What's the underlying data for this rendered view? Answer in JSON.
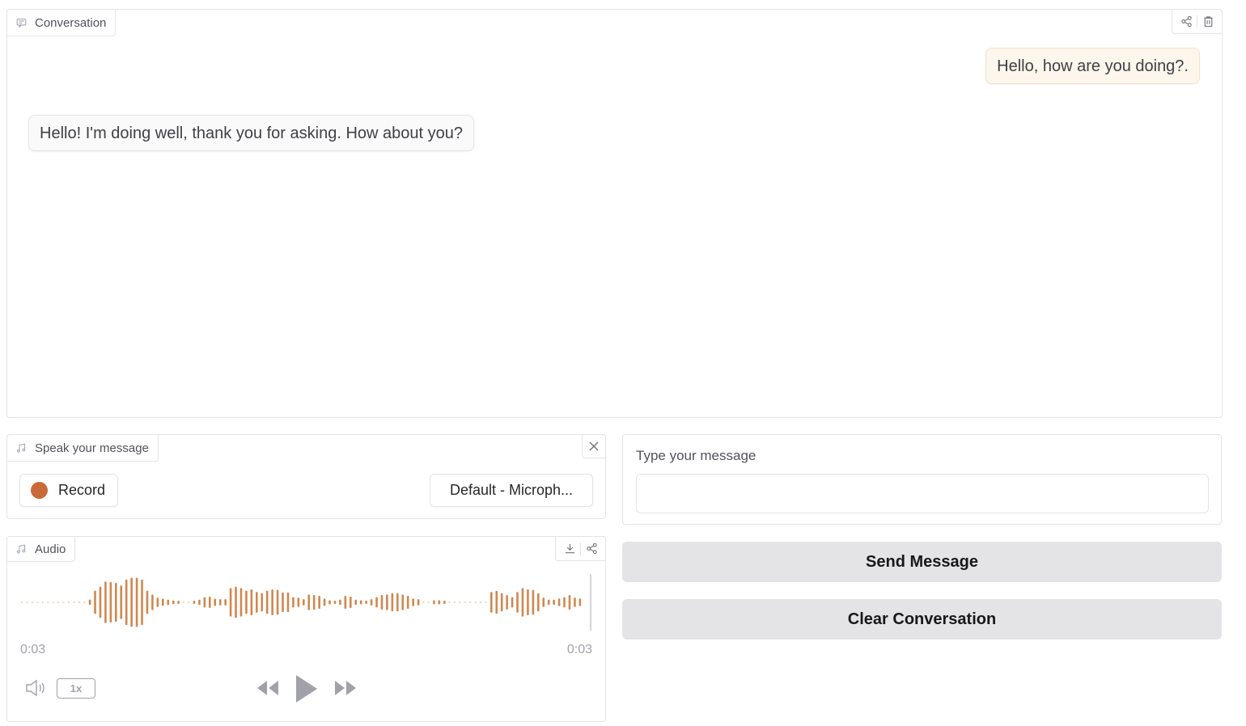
{
  "conversation": {
    "label": "Conversation",
    "icons": [
      "share-icon",
      "trash-icon"
    ],
    "messages": [
      {
        "role": "user",
        "text": "Hello, how are you doing?."
      },
      {
        "role": "bot",
        "text": "Hello! I'm doing well, thank you for asking. How about you?"
      }
    ]
  },
  "speak": {
    "label": "Speak your message",
    "record_label": "Record",
    "mic_selected": "Default - Microph..."
  },
  "audio": {
    "label": "Audio",
    "current_time": "0:03",
    "duration": "0:03",
    "playback_rate": "1x",
    "waveform_color": "#d0874f",
    "waveform": [
      0,
      0,
      0,
      0,
      0,
      0,
      0,
      0,
      0,
      0,
      0,
      0,
      0,
      0.1,
      0.45,
      0.6,
      0.8,
      0.78,
      0.75,
      0.65,
      0.88,
      0.95,
      0.95,
      0.88,
      0.45,
      0.3,
      0.18,
      0.14,
      0.1,
      0.07,
      0.05,
      0,
      0,
      0.05,
      0.1,
      0.2,
      0.22,
      0.14,
      0.12,
      0.12,
      0.55,
      0.6,
      0.55,
      0.45,
      0.5,
      0.4,
      0.35,
      0.45,
      0.5,
      0.48,
      0.38,
      0.38,
      0.2,
      0.18,
      0.12,
      0.3,
      0.28,
      0.25,
      0.14,
      0.08,
      0.05,
      0.1,
      0.25,
      0.22,
      0.1,
      0.08,
      0.05,
      0.12,
      0.2,
      0.28,
      0.3,
      0.35,
      0.35,
      0.3,
      0.25,
      0.15,
      0.12,
      0,
      0,
      0.08,
      0.08,
      0.05,
      0,
      0,
      0,
      0,
      0,
      0,
      0,
      0,
      0.4,
      0.44,
      0.35,
      0.28,
      0.2,
      0.4,
      0.55,
      0.5,
      0.48,
      0.35,
      0.18,
      0.1,
      0.1,
      0.15,
      0.2,
      0.28,
      0.18,
      0.15
    ]
  },
  "text_input": {
    "label": "Type your message",
    "value": "",
    "placeholder": ""
  },
  "buttons": {
    "send": "Send Message",
    "clear": "Clear Conversation"
  }
}
